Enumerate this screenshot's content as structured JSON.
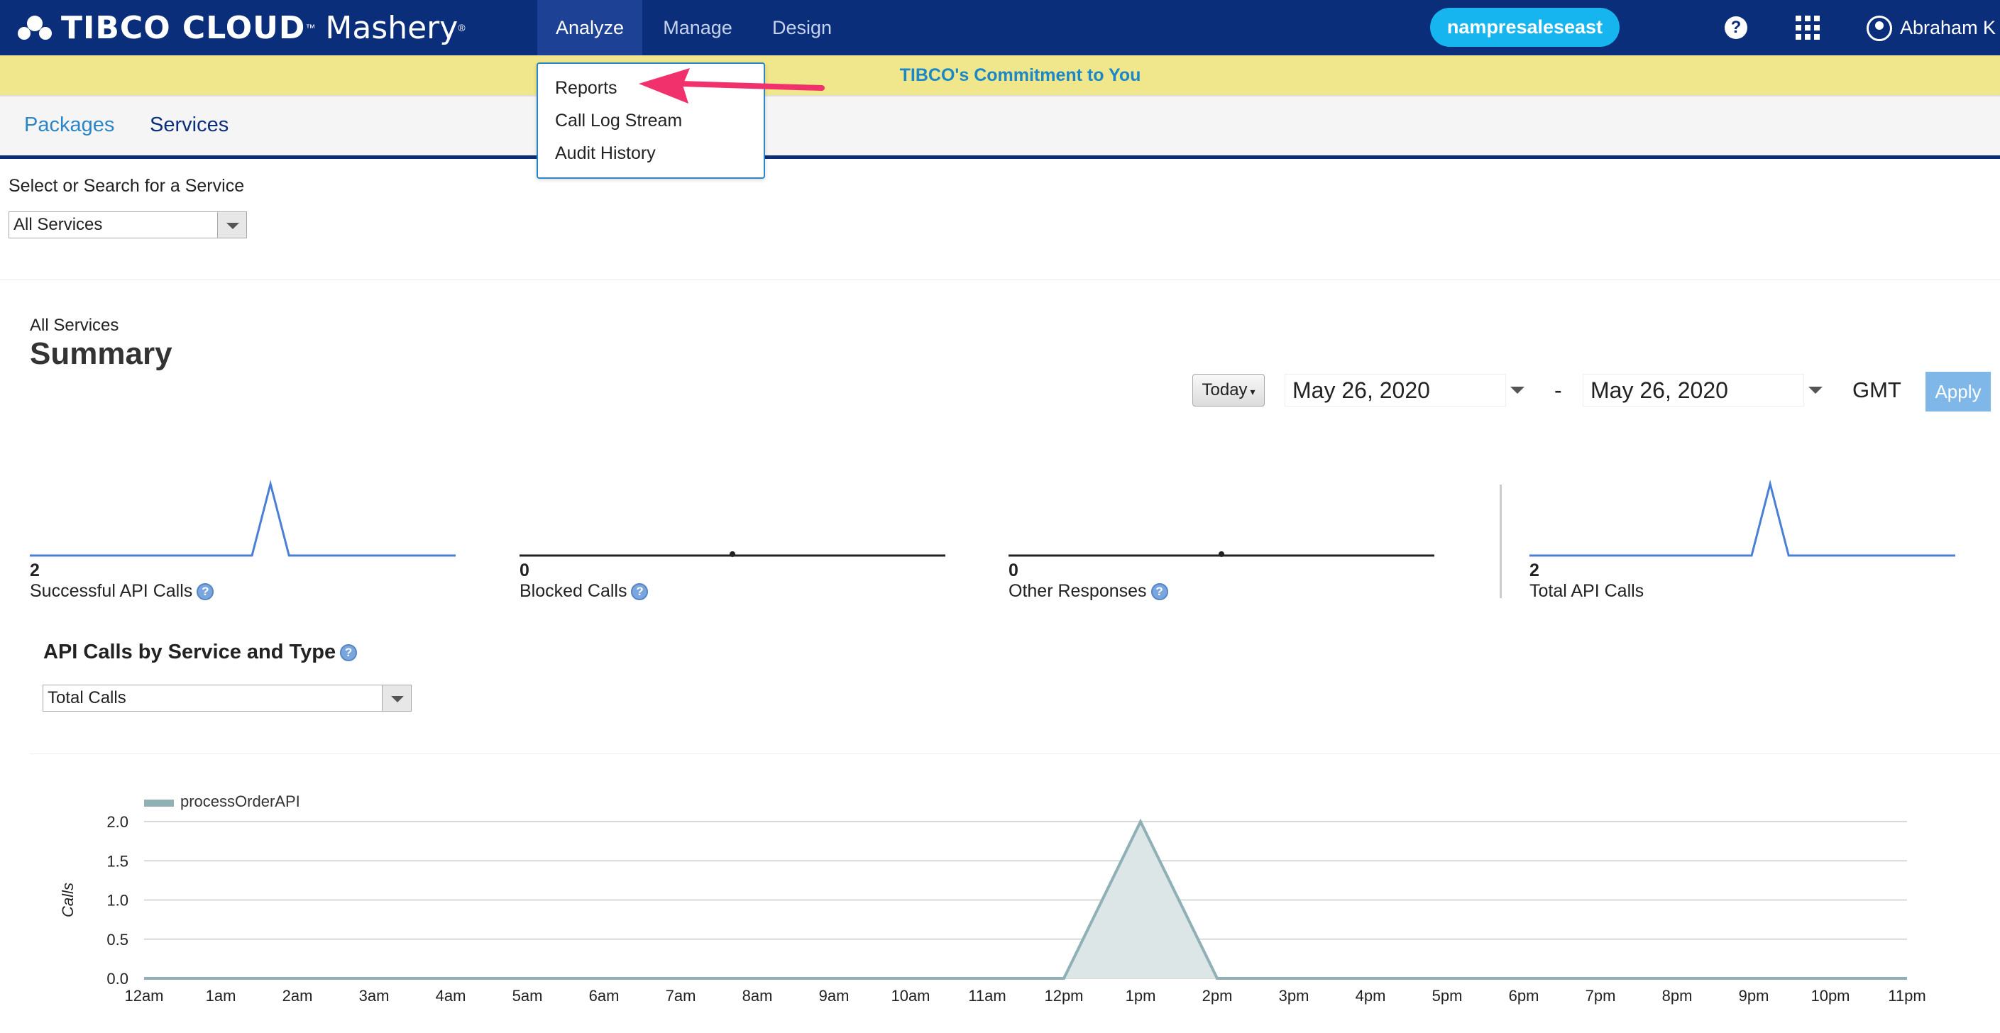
{
  "header": {
    "logo_brand": "TIBCO CLOUD",
    "logo_product": "Mashery",
    "tabs": [
      {
        "label": "Analyze",
        "active": true
      },
      {
        "label": "Manage",
        "active": false
      },
      {
        "label": "Design",
        "active": false
      }
    ],
    "org_name": "nampresaleseast",
    "help_icon": "?",
    "user_name": "Abraham K"
  },
  "banner": {
    "link_text": "TIBCO's Commitment to You"
  },
  "subnav": {
    "tabs": [
      {
        "label": "Packages"
      },
      {
        "label": "Services"
      }
    ]
  },
  "analyze_menu": {
    "items": [
      {
        "label": "Reports"
      },
      {
        "label": "Call Log Stream"
      },
      {
        "label": "Audit History"
      }
    ]
  },
  "service_select": {
    "label": "Select or Search for a Service",
    "value": "All Services"
  },
  "summary": {
    "context": "All Services",
    "title": "Summary",
    "range_button": "Today",
    "start_date": "May 26, 2020",
    "separator": "-",
    "end_date": "May 26, 2020",
    "timezone": "GMT",
    "apply_label": "Apply"
  },
  "stats": [
    {
      "value": "2",
      "label": "Successful API Calls",
      "has_info": true,
      "spark_color": "#4a7fd4",
      "spark": [
        0,
        0,
        0,
        0,
        0,
        0,
        0,
        0,
        0,
        0,
        0,
        0,
        0,
        2,
        0,
        0,
        0,
        0,
        0,
        0,
        0,
        0,
        0,
        0
      ]
    },
    {
      "value": "0",
      "label": "Blocked Calls",
      "has_info": true,
      "spark_color": "#222222",
      "spark": [
        0,
        0,
        0,
        0,
        0,
        0,
        0,
        0,
        0,
        0,
        0,
        0,
        0,
        0,
        0,
        0,
        0,
        0,
        0,
        0,
        0,
        0,
        0,
        0
      ]
    },
    {
      "value": "0",
      "label": "Other Responses",
      "has_info": true,
      "spark_color": "#222222",
      "spark": [
        0,
        0,
        0,
        0,
        0,
        0,
        0,
        0,
        0,
        0,
        0,
        0,
        0,
        0,
        0,
        0,
        0,
        0,
        0,
        0,
        0,
        0,
        0,
        0
      ]
    },
    {
      "value": "2",
      "label": "Total API Calls",
      "has_info": false,
      "spark_color": "#4a7fd4",
      "spark": [
        0,
        0,
        0,
        0,
        0,
        0,
        0,
        0,
        0,
        0,
        0,
        0,
        0,
        2,
        0,
        0,
        0,
        0,
        0,
        0,
        0,
        0,
        0,
        0
      ]
    }
  ],
  "calls_section": {
    "title": "API Calls by Service and Type",
    "type_select_value": "Total Calls"
  },
  "chart_data": {
    "type": "area",
    "x": [
      "12am",
      "1am",
      "2am",
      "3am",
      "4am",
      "5am",
      "6am",
      "7am",
      "8am",
      "9am",
      "10am",
      "11am",
      "12pm",
      "1pm",
      "2pm",
      "3pm",
      "4pm",
      "5pm",
      "6pm",
      "7pm",
      "8pm",
      "9pm",
      "10pm",
      "11pm"
    ],
    "series": [
      {
        "name": "processOrderAPI",
        "values": [
          0,
          0,
          0,
          0,
          0,
          0,
          0,
          0,
          0,
          0,
          0,
          0,
          0,
          2,
          0,
          0,
          0,
          0,
          0,
          0,
          0,
          0,
          0,
          0
        ],
        "color": "#8fb0b5",
        "fill": "#dce6e7"
      }
    ],
    "ylabel": "Calls",
    "yticks": [
      "0.0",
      "0.5",
      "1.0",
      "1.5",
      "2.0"
    ],
    "ylim": [
      0,
      2
    ],
    "grid": true,
    "legend": "top-left"
  },
  "colors": {
    "nav_bg": "#0b2e7a",
    "banner_bg": "#f0e68c",
    "accent": "#16b5f0",
    "link": "#1a88c8"
  }
}
